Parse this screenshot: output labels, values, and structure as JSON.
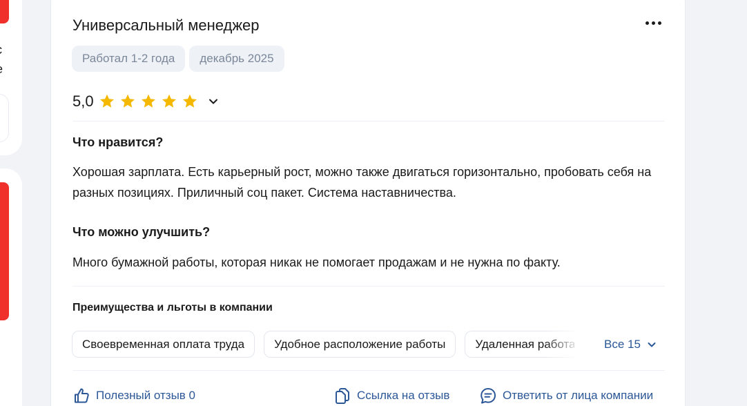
{
  "left": {
    "text_line1": "с",
    "text_line2": "е"
  },
  "review": {
    "title": "Универсальный менеджер",
    "tags": [
      "Работал 1-2 года",
      "декабрь 2025"
    ],
    "rating": {
      "value": "5,0",
      "stars": 5,
      "max": 5
    },
    "likes_heading": "Что нравится?",
    "likes_text": "Хорошая зарплата. Есть карьерный рост, можно также двигаться горизонтально, пробовать себя на разных позициях. Приличный соц пакет. Система наставничества.",
    "improve_heading": "Что можно улучшить?",
    "improve_text": "Много бумажной работы, которая никак не помогает продажам и не нужна по факту."
  },
  "benefits": {
    "title": "Преимущества и льготы в компании",
    "chips": [
      "Своевременная оплата труда",
      "Удобное расположение работы",
      "Удаленная работа"
    ],
    "all_label": "Все 15"
  },
  "actions": {
    "useful": "Полезный отзыв 0",
    "link": "Ссылка на отзыв",
    "reply": "Ответить от лица компании"
  },
  "colors": {
    "accent": "#2b5797",
    "star": "#f5b800",
    "red": "#f0302a",
    "tag_bg": "#eef1f6"
  },
  "icons": {
    "more": "more-dots-icon",
    "star": "star-icon",
    "toggle": "chevron-down-icon",
    "useful": "thumbs-up-icon",
    "link": "copy-link-icon",
    "reply": "chat-bubble-icon"
  }
}
